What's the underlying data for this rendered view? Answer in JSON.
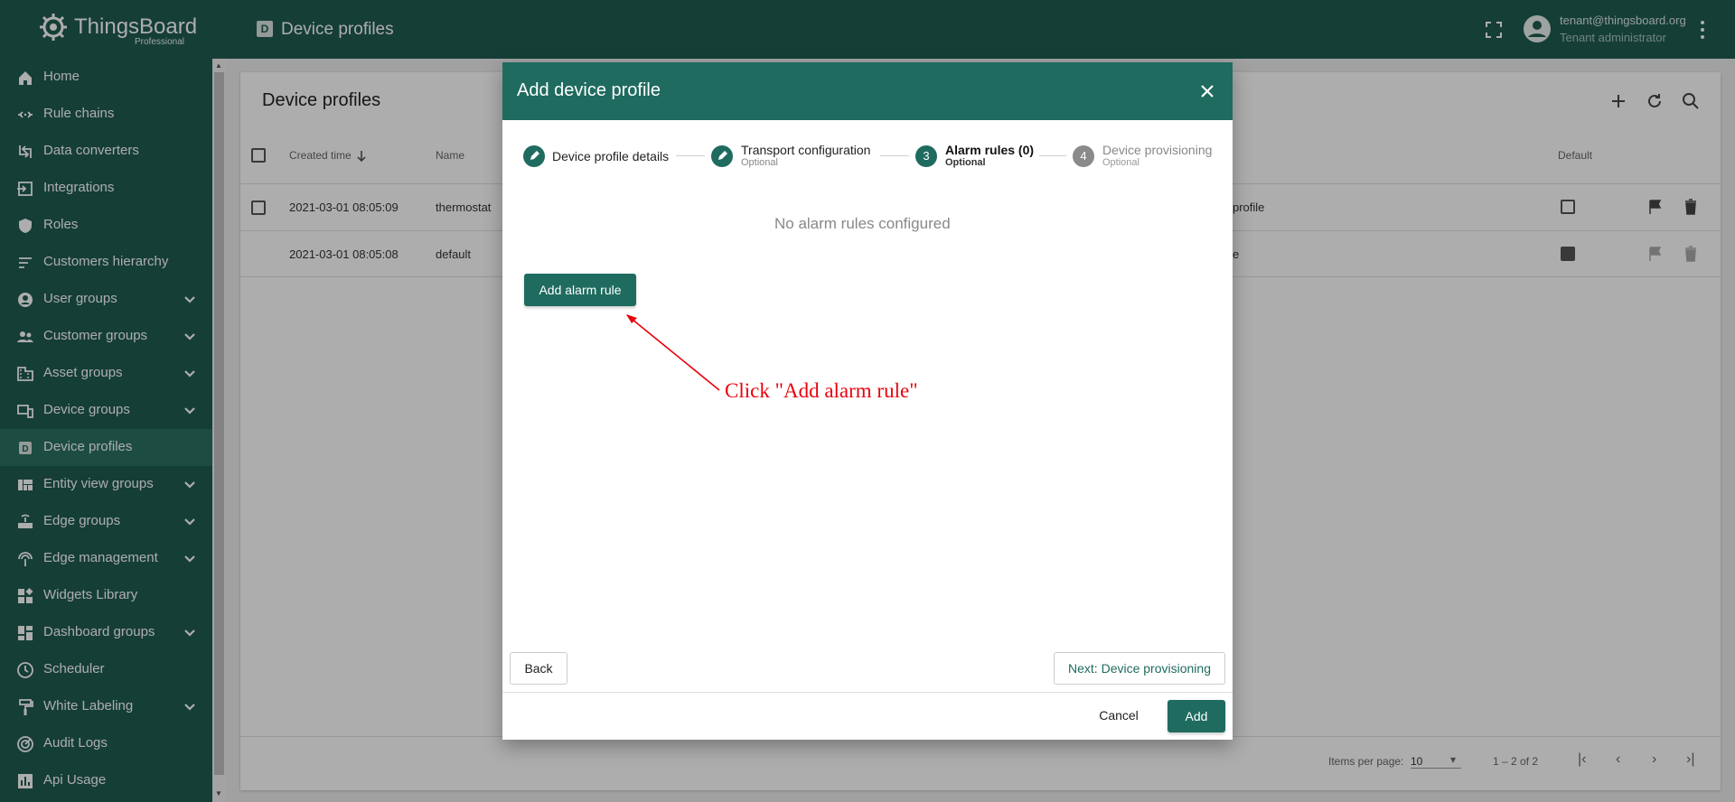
{
  "app": {
    "brand": "ThingsBoard",
    "edition": "Professional",
    "page_title": "Device profiles",
    "page_icon_letter": "D"
  },
  "user": {
    "email": "tenant@thingsboard.org",
    "role": "Tenant administrator"
  },
  "sidebar": {
    "items": [
      {
        "label": "Home",
        "icon": "home-icon",
        "expandable": false
      },
      {
        "label": "Rule chains",
        "icon": "rule-chain-icon",
        "expandable": false
      },
      {
        "label": "Data converters",
        "icon": "converter-icon",
        "expandable": false
      },
      {
        "label": "Integrations",
        "icon": "integration-icon",
        "expandable": false
      },
      {
        "label": "Roles",
        "icon": "shield-icon",
        "expandable": false
      },
      {
        "label": "Customers hierarchy",
        "icon": "hierarchy-icon",
        "expandable": false
      },
      {
        "label": "User groups",
        "icon": "account-circle-icon",
        "expandable": true
      },
      {
        "label": "Customer groups",
        "icon": "supervisor-icon",
        "expandable": true
      },
      {
        "label": "Asset groups",
        "icon": "domain-icon",
        "expandable": true
      },
      {
        "label": "Device groups",
        "icon": "devices-icon",
        "expandable": true
      },
      {
        "label": "Device profiles",
        "icon": "device-profile-icon",
        "expandable": false,
        "active": true
      },
      {
        "label": "Entity view groups",
        "icon": "view-quilt-icon",
        "expandable": true
      },
      {
        "label": "Edge groups",
        "icon": "router-icon",
        "expandable": true
      },
      {
        "label": "Edge management",
        "icon": "settings-input-antenna-icon",
        "expandable": true
      },
      {
        "label": "Widgets Library",
        "icon": "widgets-icon",
        "expandable": false
      },
      {
        "label": "Dashboard groups",
        "icon": "dashboard-icon",
        "expandable": true
      },
      {
        "label": "Scheduler",
        "icon": "schedule-icon",
        "expandable": false
      },
      {
        "label": "White Labeling",
        "icon": "format-paint-icon",
        "expandable": true
      },
      {
        "label": "Audit Logs",
        "icon": "track-changes-icon",
        "expandable": false
      },
      {
        "label": "Api Usage",
        "icon": "insert-chart-icon",
        "expandable": false
      }
    ]
  },
  "main": {
    "title": "Device profiles",
    "columns": {
      "created_time": "Created time",
      "name": "Name",
      "default": "Default"
    },
    "rows": [
      {
        "created_time": "2021-03-01 08:05:09",
        "name": "thermostat",
        "description_tail": "profile",
        "is_default": false
      },
      {
        "created_time": "2021-03-01 08:05:08",
        "name": "default",
        "description_tail": "e",
        "is_default": true
      }
    ],
    "footer": {
      "items_per_page_label": "Items per page:",
      "items_per_page_value": "10",
      "range": "1 – 2 of 2"
    }
  },
  "dialog": {
    "title": "Add device profile",
    "steps": [
      {
        "label": "Device profile details",
        "sub": "",
        "state": "edit"
      },
      {
        "label": "Transport configuration",
        "sub": "Optional",
        "state": "edit"
      },
      {
        "label": "Alarm rules (0)",
        "sub": "Optional",
        "state": "active",
        "number": "3"
      },
      {
        "label": "Device provisioning",
        "sub": "Optional",
        "state": "inactive",
        "number": "4"
      }
    ],
    "empty_message": "No alarm rules configured",
    "add_alarm_rule_label": "Add alarm rule",
    "back_label": "Back",
    "next_label": "Next: Device provisioning",
    "cancel_label": "Cancel",
    "add_label": "Add"
  },
  "annotation": {
    "text": "Click \"Add alarm rule\""
  },
  "colors": {
    "primary": "#1f5c52",
    "dialog_header": "#1f6b5f",
    "annotation": "#e8000b"
  }
}
